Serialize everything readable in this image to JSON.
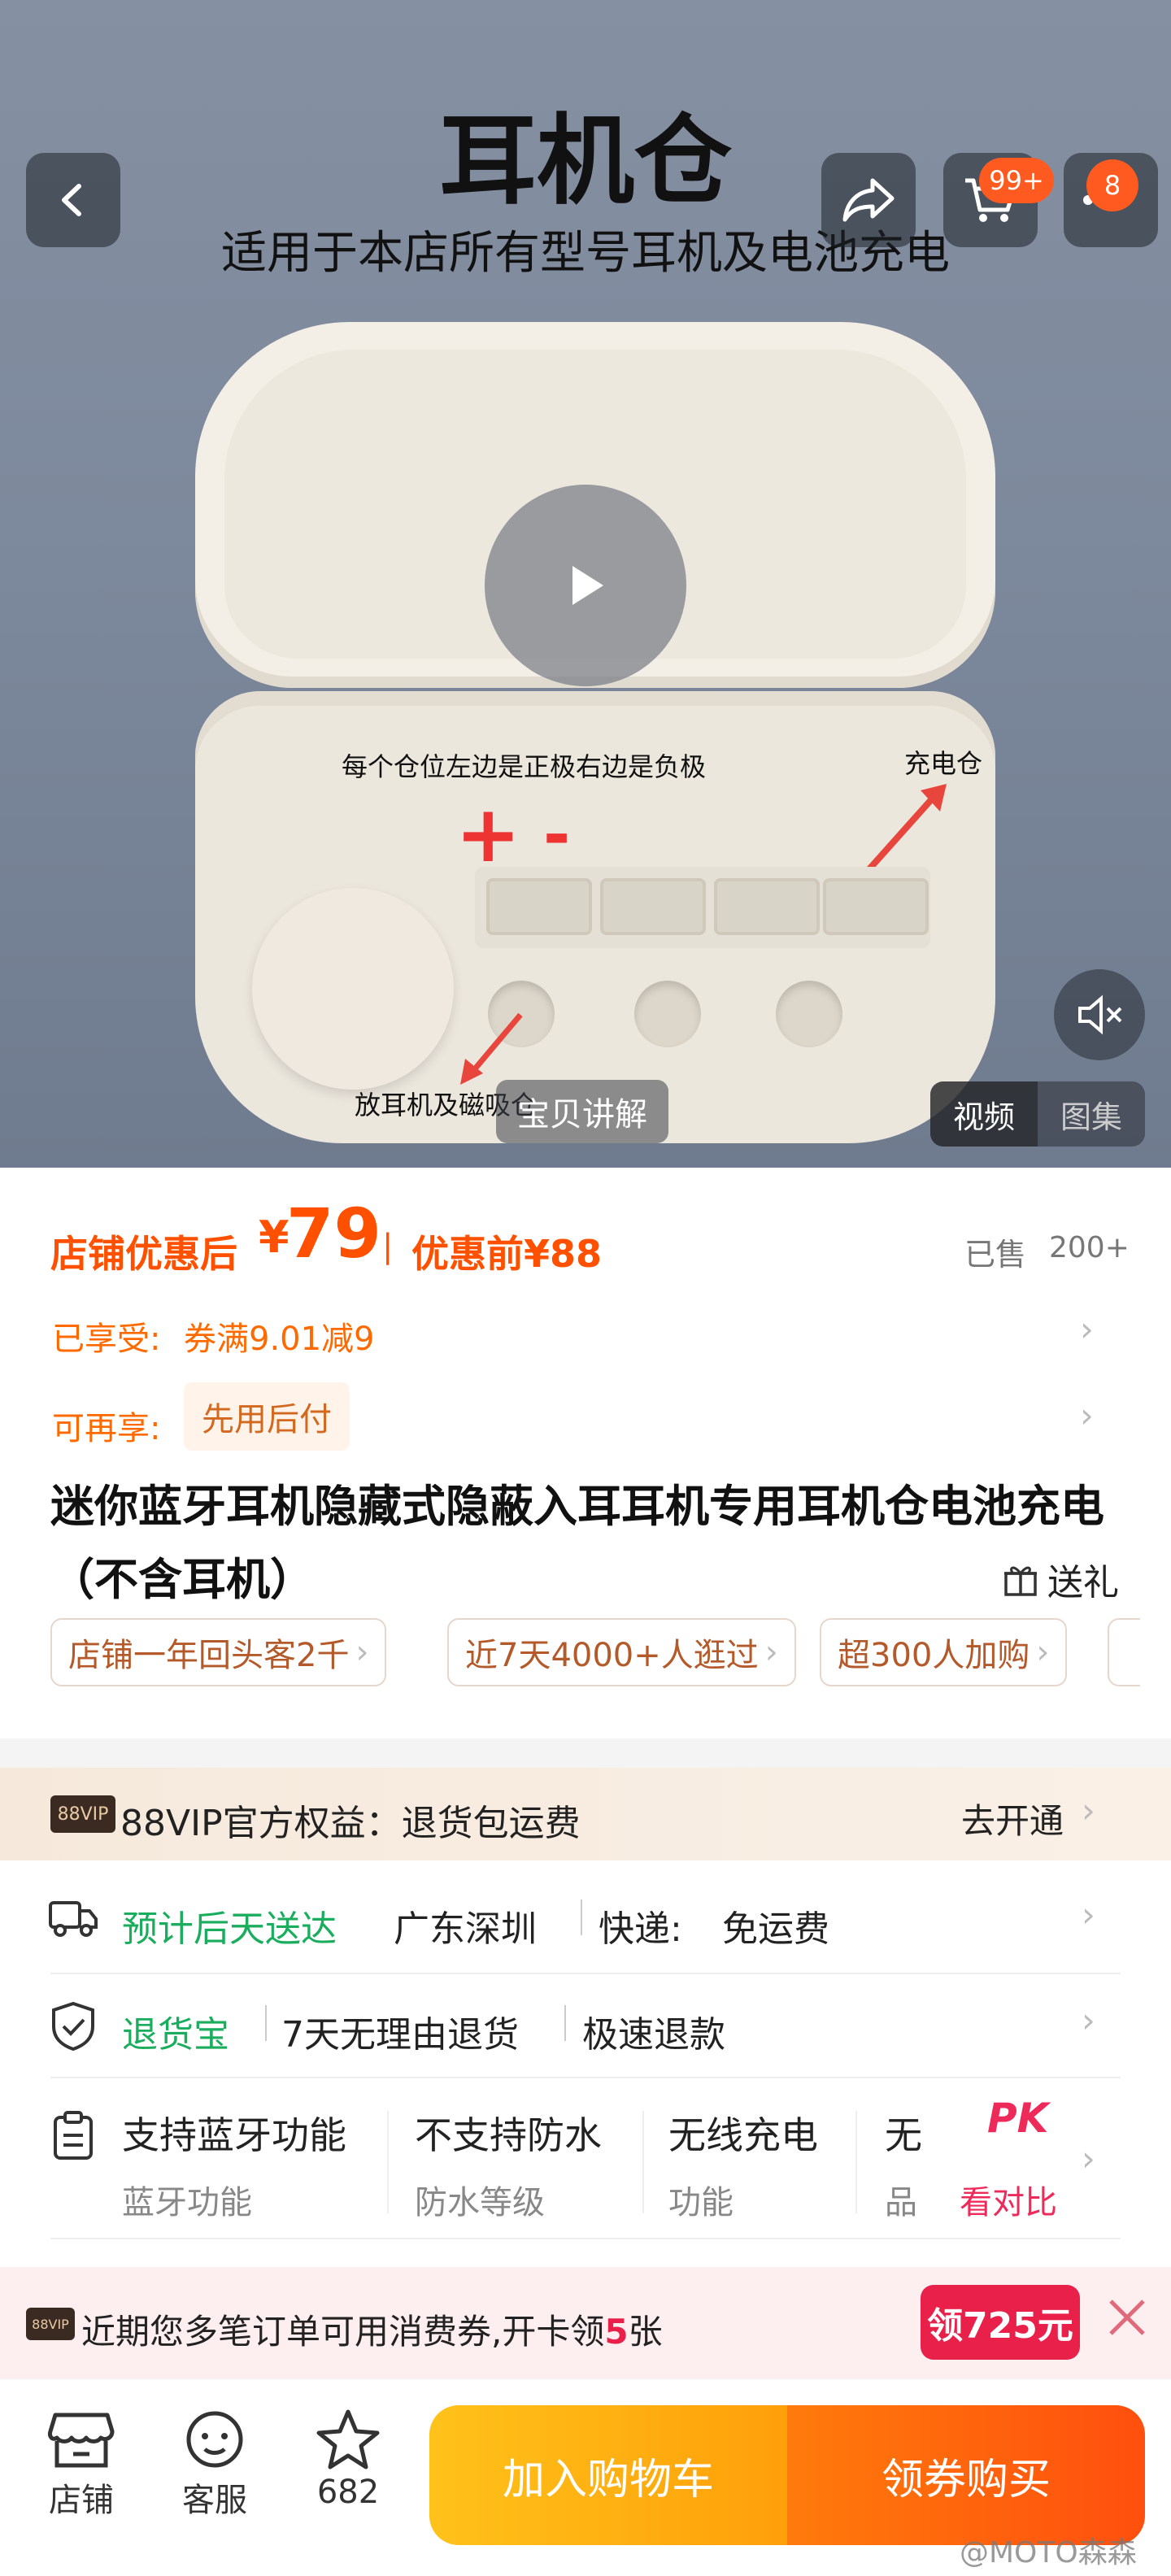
{
  "hero": {
    "title": "耳机仓",
    "subtitle": "适用于本店所有型号耳机及电池充电",
    "cart_badge": "99+",
    "more_badge": "8",
    "annotation_polarity": "每个仓位左边是正极右边是负极",
    "annotation_charge": "充电仓",
    "annotation_store": "放耳机及磁吸仓",
    "plus_sign": "+",
    "minus_sign": "-",
    "explain_label": "宝贝讲解",
    "toggle": {
      "video": "视频",
      "gallery": "图集"
    }
  },
  "price": {
    "after_label": "店铺优惠后",
    "currency": "¥",
    "after_value": "79",
    "sep": "|",
    "before_label": "优惠前¥88",
    "sold_label": "已售",
    "sold_value": "200+"
  },
  "promo": {
    "enjoyed_label": "已享受:",
    "enjoyed_value": "券满9.01减9",
    "more_label": "可再享:",
    "more_value": "先用后付"
  },
  "product": {
    "title": "迷你蓝牙耳机隐藏式隐蔽入耳耳机专用耳机仓电池充电（不含耳机）",
    "gift_label": "送礼"
  },
  "tags": [
    "店铺一年回头客2千",
    "近7天4000+人逛过",
    "超300人加购"
  ],
  "vip": {
    "logo": "88VIP",
    "text": "88VIP官方权益：退货包运费",
    "action": "去开通"
  },
  "shipping": {
    "eta": "预计后天送达",
    "origin": "广东深圳",
    "express_label": "快递:",
    "express_value": "免运费"
  },
  "returns": {
    "label": "退货宝",
    "policy": "7天无理由退货",
    "refund": "极速退款"
  },
  "specs": [
    {
      "value": "支持蓝牙功能",
      "key": "蓝牙功能"
    },
    {
      "value": "不支持防水",
      "key": "防水等级"
    },
    {
      "value": "无线充电",
      "key": "功能"
    },
    {
      "value": "无",
      "key": "品"
    }
  ],
  "compare": {
    "pk": "PK",
    "label": "看对比"
  },
  "coupon_banner": {
    "logo": "88VIP",
    "text_before": "近期您多笔订单可用消费券,开卡领",
    "count": "5",
    "text_after": "张",
    "button": "领725元"
  },
  "bottom": {
    "shop": "店铺",
    "service": "客服",
    "favorites": "682",
    "add_cart": "加入购物车",
    "buy": "领券购买"
  },
  "watermark": "@MOTO森森",
  "colors": {
    "accent": "#ff5a1f",
    "price": "#ff5000",
    "green": "#1aad5e",
    "vip_bg": "#f8eee4",
    "banner_bg": "#fdeef0"
  }
}
